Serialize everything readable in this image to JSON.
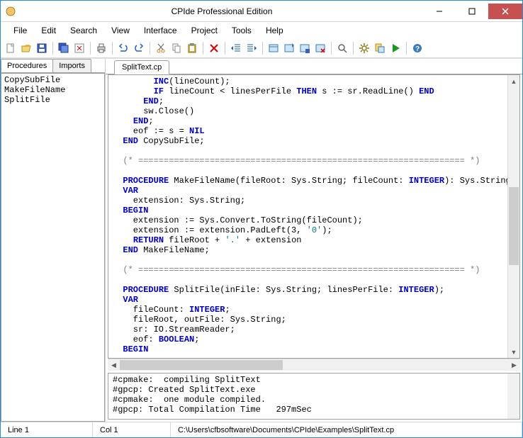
{
  "window": {
    "title": "CPIde Professional Edition"
  },
  "menu": {
    "items": [
      "File",
      "Edit",
      "Search",
      "View",
      "Interface",
      "Project",
      "Tools",
      "Help"
    ]
  },
  "sidebar": {
    "tabs": {
      "procedures": "Procedures",
      "imports": "Imports"
    },
    "items": [
      "CopySubFile",
      "MakeFileName",
      "SplitFile"
    ]
  },
  "editor": {
    "tab": "SplitText.cp"
  },
  "output": {
    "lines": [
      "#cpmake:  compiling SplitText",
      "#gpcp: Created SplitText.exe",
      "#cpmake:  one module compiled.",
      "#gpcp: Total Compilation Time   297mSec"
    ]
  },
  "status": {
    "line": "Line 1",
    "col": "Col 1",
    "path": "C:\\Users\\cfbsoftware\\Documents\\CPIde\\Examples\\SplitText.cp"
  },
  "code": {
    "t_inc": "INC",
    "t_linecount1": "(lineCount);",
    "t_if": "IF",
    "t_cond": " lineCount < linesPerFile ",
    "t_then": "THEN",
    "t_assign1": " s := sr.ReadLine() ",
    "t_end1": "END",
    "t_end2": "END",
    "t_semicolon": ";",
    "t_swclose": "      sw.Close()",
    "t_end3": "END",
    "t_eof": "    eof := s = ",
    "t_nil": "NIL",
    "t_end4": "END",
    "t_copysub": " CopySubFile;",
    "t_cmt1": "  (* ================================================================ *)",
    "t_procedure": "PROCEDURE",
    "t_mfn_sig": " MakeFileName(fileRoot: Sys.String; fileCount: ",
    "t_integer": "INTEGER",
    "t_mfn_ret": "): Sys.String;",
    "t_var": "VAR",
    "t_ext_decl": "    extension: Sys.String;",
    "t_begin": "BEGIN",
    "t_ext1": "    extension := Sys.Convert.ToString(fileCount);",
    "t_ext2a": "    extension := extension.PadLeft(3, ",
    "t_zero": "'0'",
    "t_ext2b": ");",
    "t_return": "RETURN",
    "t_ret_expr_a": " fileRoot + ",
    "t_dot": "'.'",
    "t_ret_expr_b": " + extension",
    "t_end5": "END",
    "t_mfn_end": " MakeFileName;",
    "t_cmt2": "  (* ================================================================ *)",
    "t_sf_sig": " SplitFile(inFile: Sys.String; linesPerFile: ",
    "t_sf_end": ");",
    "t_fc": "    fileCount: ",
    "t_fr": "    fileRoot, outFile: Sys.String;",
    "t_sr": "    sr: IO.StreamReader;",
    "t_eofd": "    eof: ",
    "t_boolean": "BOOLEAN",
    "t_blank": ""
  }
}
